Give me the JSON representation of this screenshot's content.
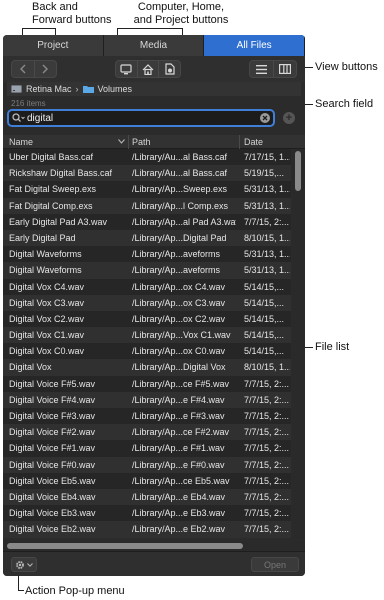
{
  "callouts": {
    "back_forward": "Back and\nForward buttons",
    "computer_home_project": "Computer, Home,\nand Project buttons",
    "view_buttons": "View buttons",
    "search_field": "Search field",
    "file_list": "File list",
    "action_popup": "Action Pop-up menu"
  },
  "tabs": [
    {
      "label": "Project",
      "active": false
    },
    {
      "label": "Media",
      "active": false
    },
    {
      "label": "All Files",
      "active": true
    }
  ],
  "path": {
    "volume": "Retina Mac",
    "folder": "Volumes"
  },
  "item_count": "216 items",
  "search": {
    "value": "digital"
  },
  "columns": {
    "name": "Name",
    "path": "Path",
    "date": "Date"
  },
  "rows": [
    {
      "name": "Uber Digital Bass.caf",
      "path": "/Library/Au...al Bass.caf",
      "date": "7/17/15, 1..."
    },
    {
      "name": "Rickshaw Digital Bass.caf",
      "path": "/Library/Au...al Bass.caf",
      "date": "5/19/15,..."
    },
    {
      "name": "Fat Digital Sweep.exs",
      "path": "/Library/Ap...Sweep.exs",
      "date": "5/31/13, 1..."
    },
    {
      "name": "Fat Digital Comp.exs",
      "path": "/Library/Ap...l Comp.exs",
      "date": "5/31/13, 1..."
    },
    {
      "name": "Early Digital Pad A3.wav",
      "path": "/Library/Ap...al Pad A3.wav",
      "date": "7/7/15, 2:..."
    },
    {
      "name": "Early Digital Pad",
      "path": "/Library/Ap...Digital Pad",
      "date": "8/10/15, 1..."
    },
    {
      "name": "Digital Waveforms",
      "path": "/Library/Ap...aveforms",
      "date": "5/31/13, 1..."
    },
    {
      "name": "Digital Waveforms",
      "path": "/Library/Ap...aveforms",
      "date": "5/31/13, 1..."
    },
    {
      "name": "Digital Vox C4.wav",
      "path": "/Library/Ap...ox C4.wav",
      "date": "5/14/15,..."
    },
    {
      "name": "Digital Vox C3.wav",
      "path": "/Library/Ap...ox C3.wav",
      "date": "5/14/15,..."
    },
    {
      "name": "Digital Vox C2.wav",
      "path": "/Library/Ap...ox C2.wav",
      "date": "5/14/15,..."
    },
    {
      "name": "Digital Vox C1.wav",
      "path": "/Library/Ap...Vox C1.wav",
      "date": "5/14/15,..."
    },
    {
      "name": "Digital Vox C0.wav",
      "path": "/Library/Ap...ox C0.wav",
      "date": "5/14/15,..."
    },
    {
      "name": "Digital Vox",
      "path": "/Library/Ap...Digital Vox",
      "date": "8/10/15, 1..."
    },
    {
      "name": "Digital Voice F#5.wav",
      "path": "/Library/Ap...ce F#5.wav",
      "date": "7/7/15, 2:..."
    },
    {
      "name": "Digital Voice F#4.wav",
      "path": "/Library/Ap...e F#4.wav",
      "date": "7/7/15, 2:..."
    },
    {
      "name": "Digital Voice F#3.wav",
      "path": "/Library/Ap...e F#3.wav",
      "date": "7/7/15, 2:..."
    },
    {
      "name": "Digital Voice F#2.wav",
      "path": "/Library/Ap...ce F#2.wav",
      "date": "7/7/15, 2:..."
    },
    {
      "name": "Digital Voice F#1.wav",
      "path": "/Library/Ap...e F#1.wav",
      "date": "7/7/15, 2:..."
    },
    {
      "name": "Digital Voice F#0.wav",
      "path": "/Library/Ap...e F#0.wav",
      "date": "7/7/15, 2:..."
    },
    {
      "name": "Digital Voice Eb5.wav",
      "path": "/Library/Ap...ce Eb5.wav",
      "date": "7/7/15, 2:..."
    },
    {
      "name": "Digital Voice Eb4.wav",
      "path": "/Library/Ap...e Eb4.wav",
      "date": "7/7/15, 2:..."
    },
    {
      "name": "Digital Voice Eb3.wav",
      "path": "/Library/Ap...e Eb3.wav",
      "date": "7/7/15, 2:..."
    },
    {
      "name": "Digital Voice Eb2.wav",
      "path": "/Library/Ap...e Eb2.wav",
      "date": "7/7/15, 2:..."
    }
  ],
  "footer": {
    "open_label": "Open"
  },
  "colors": {
    "accent": "#2f6fd0",
    "panel": "#2b2b2b",
    "folder": "#5aa9e6"
  },
  "icons": [
    "back-icon",
    "forward-icon",
    "computer-icon",
    "home-icon",
    "project-icon",
    "list-view-icon",
    "column-view-icon",
    "disk-icon",
    "folder-icon",
    "search-icon",
    "clear-icon",
    "add-icon",
    "sort-chevron-icon",
    "gear-icon",
    "chevron-down-icon"
  ]
}
